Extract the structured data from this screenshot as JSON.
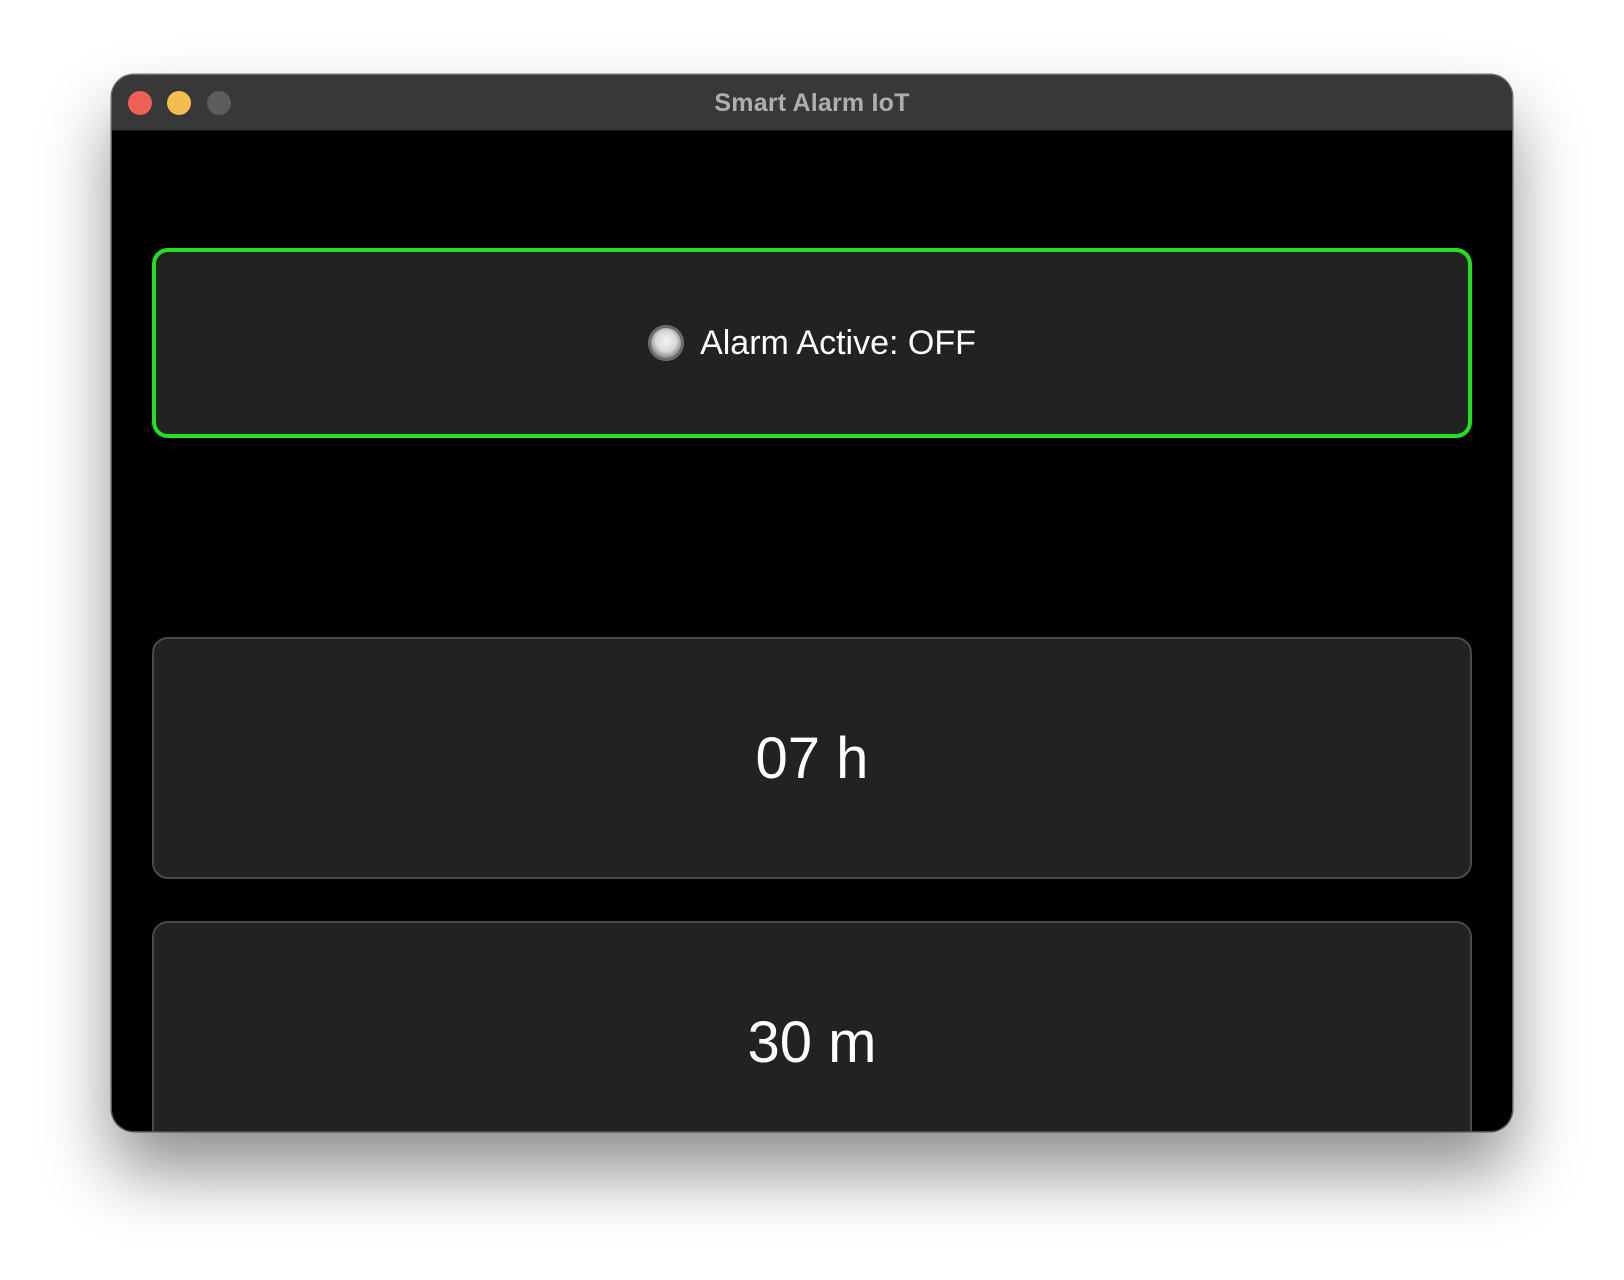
{
  "window": {
    "title": "Smart Alarm IoT",
    "traffic_lights": {
      "close_color": "#ee5f57",
      "minimize_color": "#f5bd4f",
      "zoom_color": "#5d5d5d"
    }
  },
  "alarm": {
    "label": "Alarm Active: OFF",
    "active": false,
    "border_color": "#22e022"
  },
  "time": {
    "hours_label": "07 h",
    "minutes_label": "30 m"
  }
}
